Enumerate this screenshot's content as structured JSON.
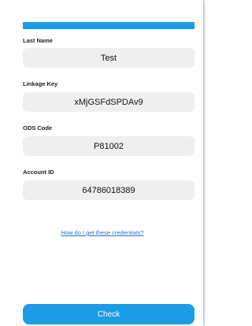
{
  "form": {
    "fields": [
      {
        "label": "Last Name",
        "value": "Test"
      },
      {
        "label": "Linkage Key",
        "value": "xMjGSFdSPDAv9"
      },
      {
        "label": "ODS Code",
        "value": "P81002"
      },
      {
        "label": "Account ID",
        "value": "64786018389"
      }
    ],
    "help_link": "How do I get these credentials?",
    "check_label": "Check"
  },
  "colors": {
    "accent": "#1c9ce6",
    "link": "#2f6fd1",
    "field_bg": "#efefef"
  }
}
